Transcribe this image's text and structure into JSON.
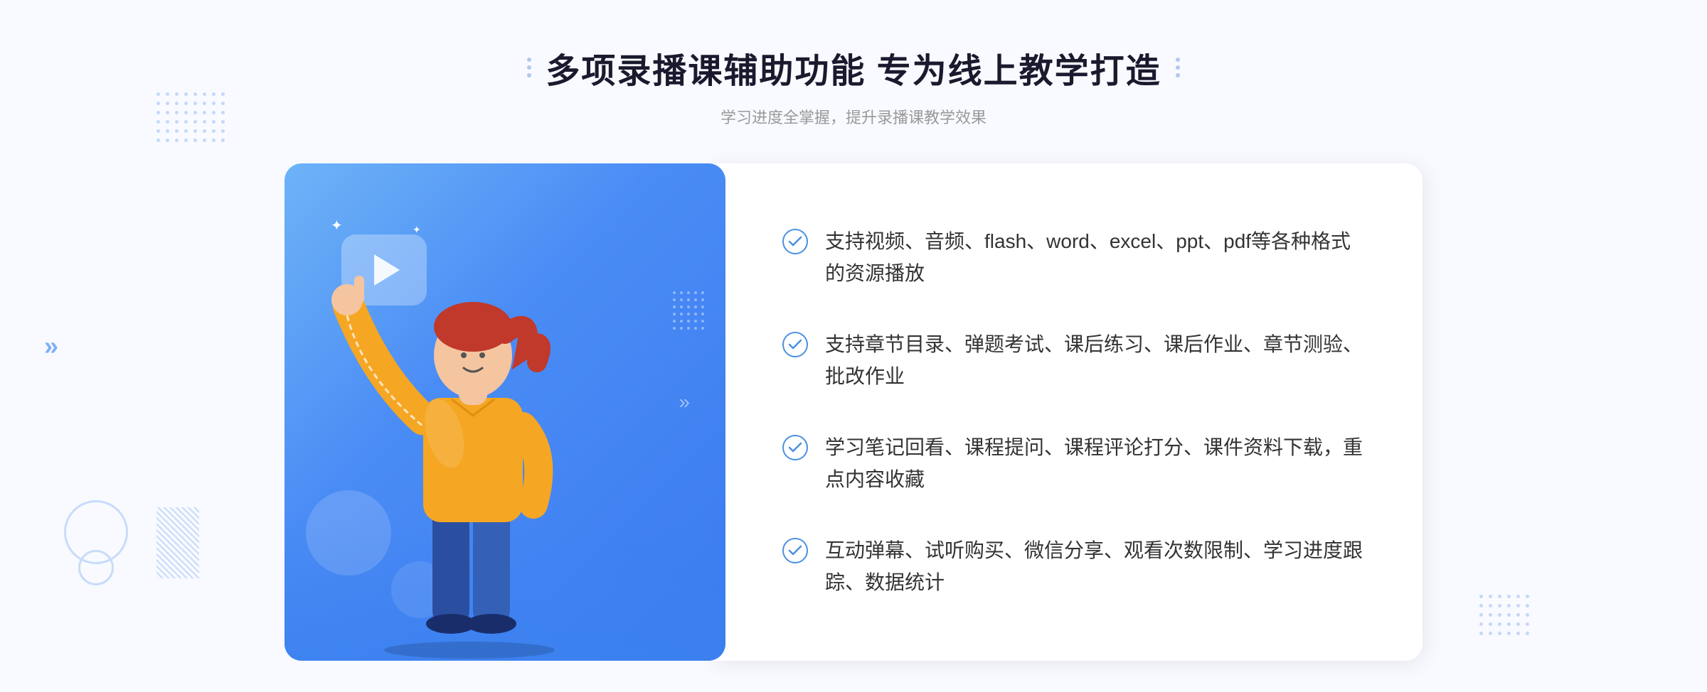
{
  "header": {
    "main_title": "多项录播课辅助功能 专为线上教学打造",
    "sub_title": "学习进度全掌握，提升录播课教学效果"
  },
  "features": [
    {
      "id": 1,
      "text": "支持视频、音频、flash、word、excel、ppt、pdf等各种格式的资源播放"
    },
    {
      "id": 2,
      "text": "支持章节目录、弹题考试、课后练习、课后作业、章节测验、批改作业"
    },
    {
      "id": 3,
      "text": "学习笔记回看、课程提问、课程评论打分、课件资料下载，重点内容收藏"
    },
    {
      "id": 4,
      "text": "互动弹幕、试听购买、微信分享、观看次数限制、学习进度跟踪、数据统计"
    }
  ],
  "decorations": {
    "chevron": "»",
    "sparkle": "✦"
  }
}
